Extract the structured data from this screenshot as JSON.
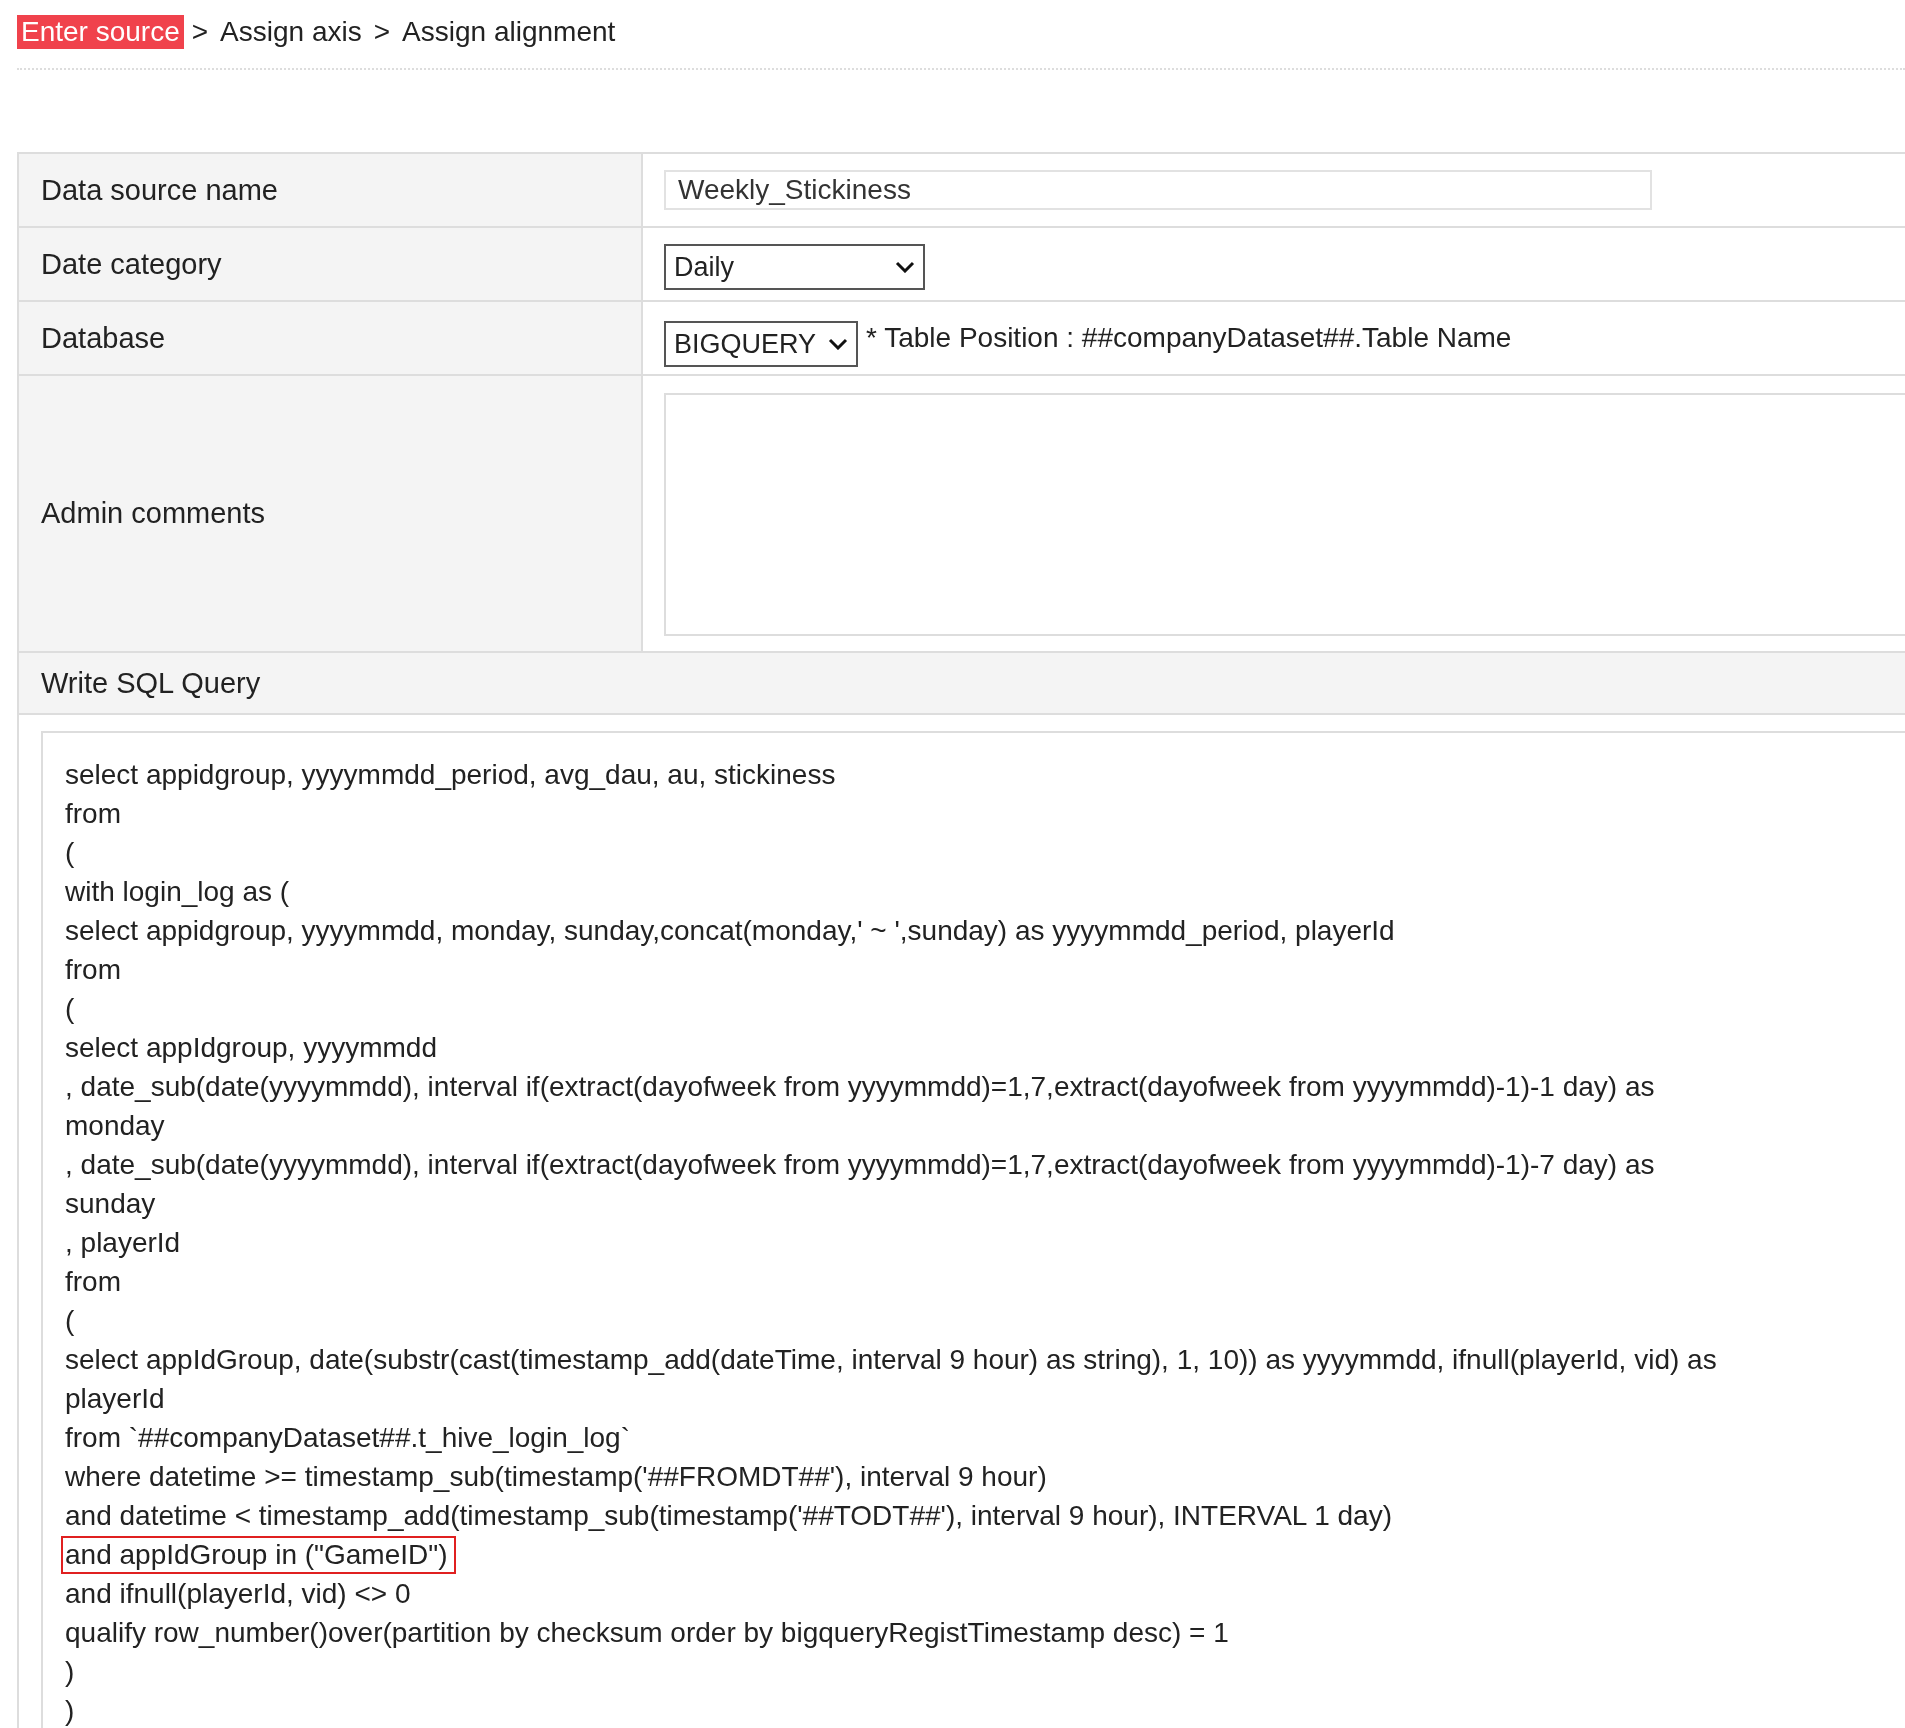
{
  "breadcrumb": [
    {
      "kind": "step",
      "label": "Enter source",
      "selected": true
    },
    {
      "kind": "separator",
      "label": ">"
    },
    {
      "kind": "step",
      "label": "Assign axis",
      "selected": false
    },
    {
      "kind": "separator",
      "label": ">"
    },
    {
      "kind": "step",
      "label": "Assign alignment",
      "selected": false
    }
  ],
  "form": {
    "rows": [
      {
        "label": "Data source name",
        "kind": "text",
        "value": "Weekly_Stickiness"
      },
      {
        "label": "Date category",
        "kind": "select",
        "value": "Daily"
      },
      {
        "label": "Database",
        "kind": "select-note",
        "value": "BIGQUERY",
        "note": "* Table Position : ##companyDataset##.Table Name"
      },
      {
        "label": "Admin comments",
        "kind": "textarea"
      }
    ]
  },
  "sql": {
    "heading": "Write SQL Query",
    "lines": [
      {
        "text": "select appidgroup, yyyymmdd_period, avg_dau, au, stickiness",
        "highlighted": false
      },
      {
        "text": "from",
        "highlighted": false
      },
      {
        "text": "(",
        "highlighted": false
      },
      {
        "text": "with login_log as (",
        "highlighted": false
      },
      {
        "text": "select appidgroup, yyyymmdd, monday, sunday,concat(monday,' ~ ',sunday) as yyyymmdd_period, playerId",
        "highlighted": false
      },
      {
        "text": "from",
        "highlighted": false
      },
      {
        "text": "(",
        "highlighted": false
      },
      {
        "text": "select appIdgroup, yyyymmdd",
        "highlighted": false
      },
      {
        "text": ", date_sub(date(yyyymmdd), interval if(extract(dayofweek from yyyymmdd)=1,7,extract(dayofweek from yyyymmdd)-1)-1 day) as",
        "highlighted": false
      },
      {
        "text": "monday",
        "highlighted": false
      },
      {
        "text": ", date_sub(date(yyyymmdd), interval if(extract(dayofweek from yyyymmdd)=1,7,extract(dayofweek from yyyymmdd)-1)-7 day) as",
        "highlighted": false
      },
      {
        "text": "sunday",
        "highlighted": false
      },
      {
        "text": ", playerId",
        "highlighted": false
      },
      {
        "text": "from",
        "highlighted": false
      },
      {
        "text": "(",
        "highlighted": false
      },
      {
        "text": "select appIdGroup, date(substr(cast(timestamp_add(dateTime, interval 9 hour) as string), 1, 10)) as yyyymmdd, ifnull(playerId, vid) as",
        "highlighted": false
      },
      {
        "text": "playerId",
        "highlighted": false
      },
      {
        "text": "from `##companyDataset##.t_hive_login_log`",
        "highlighted": false
      },
      {
        "text": "where datetime >= timestamp_sub(timestamp('##FROMDT##'), interval 9 hour)",
        "highlighted": false
      },
      {
        "text": "and datetime < timestamp_add(timestamp_sub(timestamp('##TODT##'), interval 9 hour), INTERVAL 1 day)",
        "highlighted": false
      },
      {
        "text": "and appIdGroup in (\"GameID\")",
        "highlighted": true
      },
      {
        "text": "and ifnull(playerId, vid) <> 0",
        "highlighted": false
      },
      {
        "text": "qualify row_number()over(partition by checksum order by bigqueryRegistTimestamp desc) = 1",
        "highlighted": false
      },
      {
        "text": ")",
        "highlighted": false
      },
      {
        "text": ")",
        "highlighted": false
      }
    ]
  }
}
